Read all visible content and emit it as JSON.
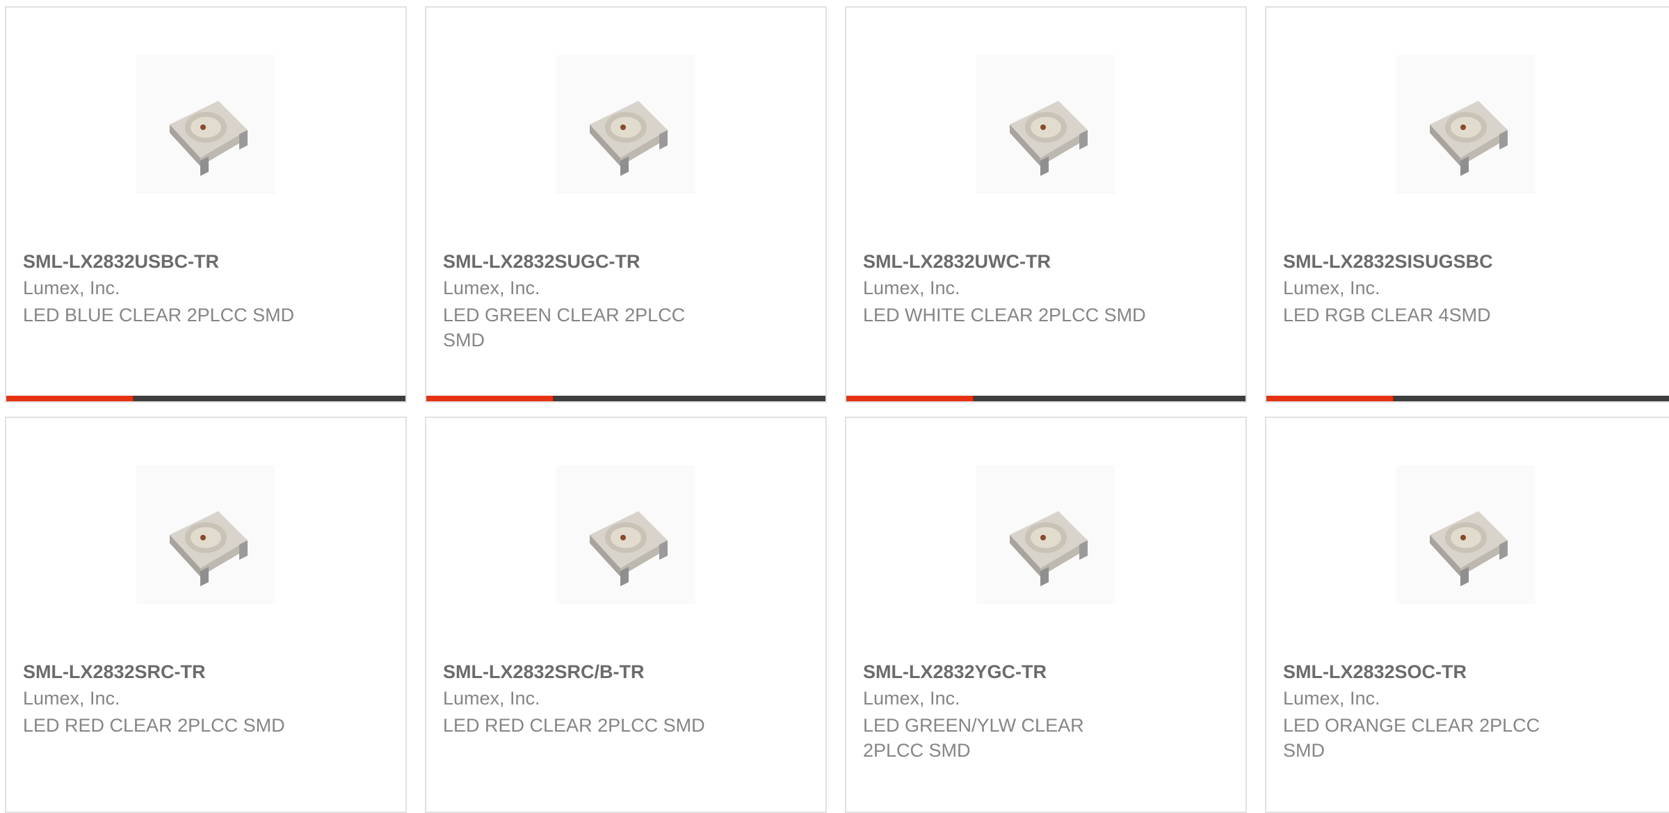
{
  "accent_color": "#e53312",
  "bar_color": "#3e3e3e",
  "products": [
    {
      "part": "SML-LX2832USBC-TR",
      "maker": "Lumex, Inc.",
      "description": "LED BLUE CLEAR 2PLCC SMD",
      "image_icon": "smd-led-icon"
    },
    {
      "part": "SML-LX2832SUGC-TR",
      "maker": "Lumex, Inc.",
      "description": "LED GREEN CLEAR 2PLCC SMD",
      "image_icon": "smd-led-icon"
    },
    {
      "part": "SML-LX2832UWC-TR",
      "maker": "Lumex, Inc.",
      "description": "LED WHITE CLEAR 2PLCC SMD",
      "image_icon": "smd-led-icon"
    },
    {
      "part": "SML-LX2832SISUGSBC",
      "maker": "Lumex, Inc.",
      "description": "LED RGB CLEAR 4SMD",
      "image_icon": "smd-led-icon"
    },
    {
      "part": "SML-LX2832SRC-TR",
      "maker": "Lumex, Inc.",
      "description": "LED RED CLEAR 2PLCC SMD",
      "image_icon": "smd-led-icon"
    },
    {
      "part": "SML-LX2832SRC/B-TR",
      "maker": "Lumex, Inc.",
      "description": "LED RED CLEAR 2PLCC SMD",
      "image_icon": "smd-led-icon"
    },
    {
      "part": "SML-LX2832YGC-TR",
      "maker": "Lumex, Inc.",
      "description": "LED GREEN/YLW CLEAR 2PLCC SMD",
      "image_icon": "smd-led-icon"
    },
    {
      "part": "SML-LX2832SOC-TR",
      "maker": "Lumex, Inc.",
      "description": "LED ORANGE CLEAR 2PLCC SMD",
      "image_icon": "smd-led-icon"
    }
  ]
}
